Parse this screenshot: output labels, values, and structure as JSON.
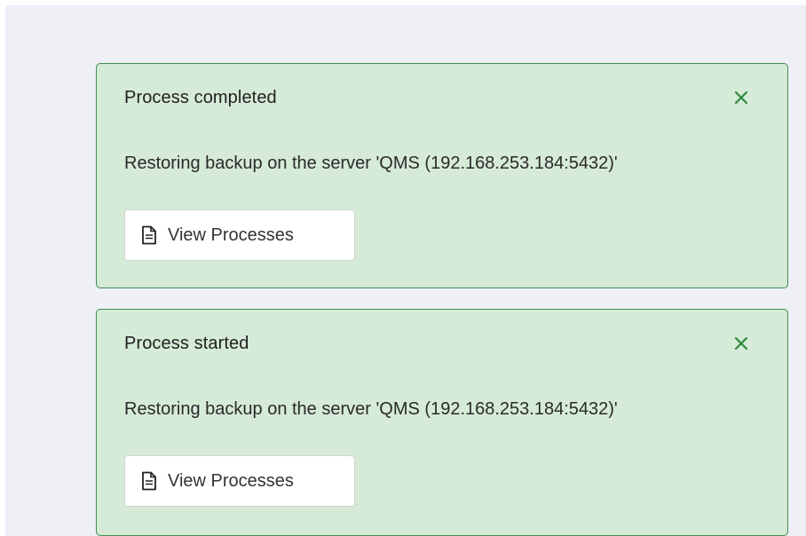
{
  "notifications": [
    {
      "title": "Process completed",
      "message": "Restoring backup on the server 'QMS (192.168.253.184:5432)'",
      "action_label": "View Processes",
      "action_icon": "document-icon",
      "close_icon": "close-icon"
    },
    {
      "title": "Process started",
      "message": "Restoring backup on the server 'QMS (192.168.253.184:5432)'",
      "action_label": "View Processes",
      "action_icon": "document-icon",
      "close_icon": "close-icon"
    }
  ],
  "colors": {
    "toast_background": "#d6ead8",
    "toast_border": "#3e8e50",
    "close_icon": "#2e8b3a",
    "page_background": "#eef0f6"
  }
}
